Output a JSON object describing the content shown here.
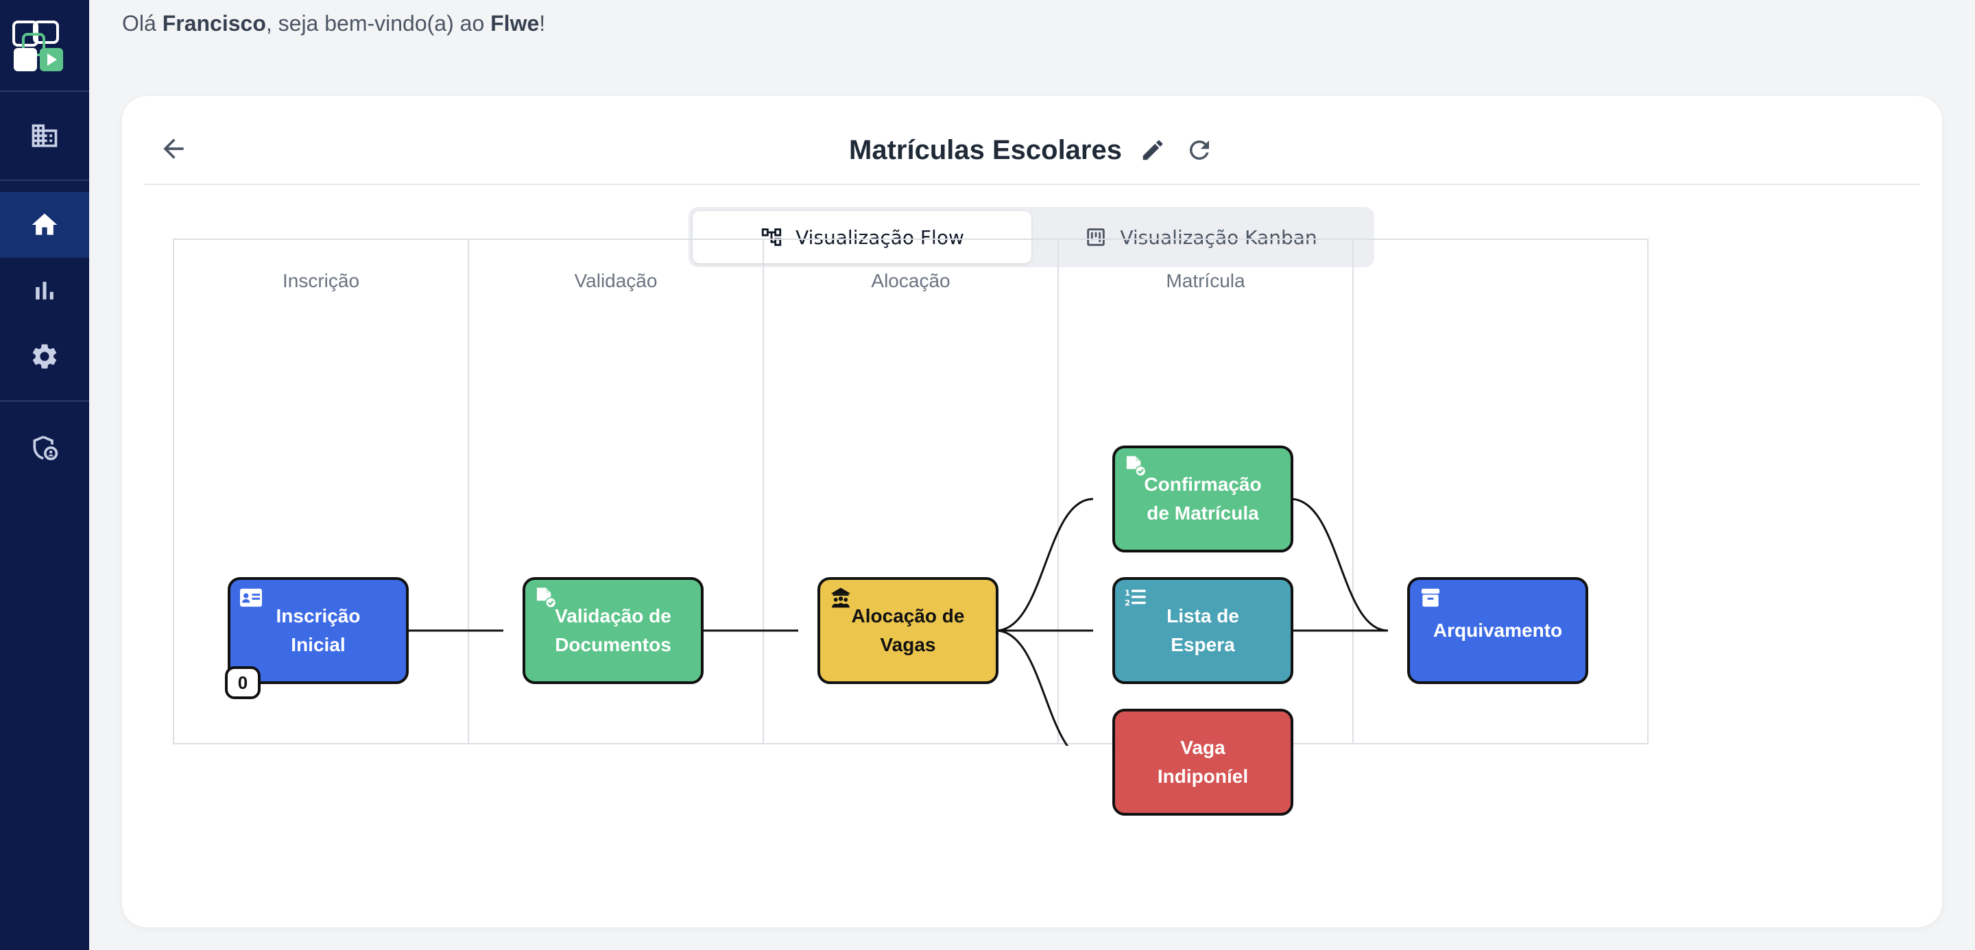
{
  "sidebar": {
    "logo": "app-logo",
    "items": [
      {
        "name": "buildings-icon",
        "active": false
      },
      {
        "name": "home-icon",
        "active": true
      },
      {
        "name": "bar-chart-icon",
        "active": false
      },
      {
        "name": "gear-icon",
        "active": false
      },
      {
        "name": "shield-icon",
        "active": false
      }
    ]
  },
  "greeting": {
    "prefix": "Olá ",
    "user": "Francisco",
    "middle": ", seja bem-vindo(a) ao ",
    "app": "Flwe",
    "suffix": "!"
  },
  "header": {
    "title": "Matrículas Escolares",
    "back_icon": "arrow-left-icon",
    "edit_icon": "pencil-icon",
    "refresh_icon": "refresh-icon"
  },
  "view_toggle": {
    "options": [
      {
        "label": "Visualização Flow",
        "icon": "flow-icon",
        "active": true
      },
      {
        "label": "Visualização Kanban",
        "icon": "kanban-icon",
        "active": false
      }
    ]
  },
  "flow": {
    "lanes": [
      "Inscrição",
      "Validação",
      "Alocação",
      "Matrícula",
      ""
    ],
    "nodes": [
      {
        "id": "inscricao",
        "label": "Inscrição\nInicial",
        "color": "#3d6be6",
        "icon": "id-card-icon",
        "count": "0"
      },
      {
        "id": "validacao",
        "label": "Validação de\nDocumentos",
        "color": "#5cc48a",
        "icon": "document-check-icon"
      },
      {
        "id": "alocacao",
        "label": "Alocação de\nVagas",
        "color": "#ecc54d",
        "icon": "school-people-icon"
      },
      {
        "id": "confirmacao",
        "label": "Confirmação\nde Matrícula",
        "color": "#5cc48a",
        "icon": "document-check-icon"
      },
      {
        "id": "lista",
        "label": "Lista de\nEspera",
        "color": "#4aa2b6",
        "icon": "numbered-list-icon"
      },
      {
        "id": "vaga",
        "label": "Vaga\nIndiponíel",
        "color": "#d65353",
        "icon": ""
      },
      {
        "id": "arquivamento",
        "label": "Arquivamento",
        "color": "#3d6be6",
        "icon": "archive-icon"
      }
    ]
  }
}
